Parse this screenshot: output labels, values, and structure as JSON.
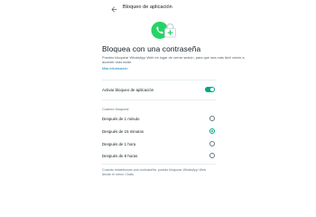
{
  "header": {
    "title": "Bloqueo de aplicación"
  },
  "intro": {
    "headline": "Bloquea con una contraseña",
    "description": "Puedes bloquear WhatsApp Web en lugar de cerrar sesión, para que sea más fácil volver a acceder más tarde.",
    "more_link": "Más información"
  },
  "toggle": {
    "label": "Activar bloqueo de aplicación",
    "enabled": true
  },
  "lock_section": {
    "title": "Cuándo bloquear",
    "options": [
      {
        "label": "Después de 1 minuto",
        "selected": false
      },
      {
        "label": "Después de 15 minutos",
        "selected": true
      },
      {
        "label": "Después de 1 hora",
        "selected": false
      },
      {
        "label": "Después de 8 horas",
        "selected": false
      }
    ]
  },
  "footer": {
    "note": "Cuando establezcas una contraseña, podrás bloquear WhatsApp Web desde el menú Chats."
  },
  "colors": {
    "accent": "#00a884",
    "link": "#027eb5",
    "text": "#111b21",
    "muted": "#667781"
  },
  "icons": {
    "back": "arrow-left-icon",
    "hero": "whatsapp-lock-icon"
  }
}
